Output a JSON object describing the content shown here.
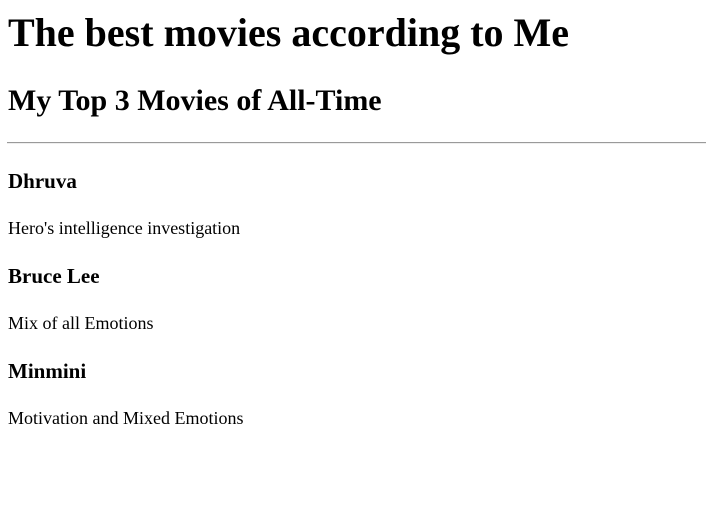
{
  "page": {
    "heading": "The best movies according to Me",
    "subheading": "My Top 3 Movies of All-Time"
  },
  "movies": [
    {
      "title": "Dhruva",
      "description": "Hero's intelligence investigation"
    },
    {
      "title": "Bruce Lee",
      "description": "Mix of all Emotions"
    },
    {
      "title": "Minmini",
      "description": "Motivation and Mixed Emotions"
    }
  ]
}
